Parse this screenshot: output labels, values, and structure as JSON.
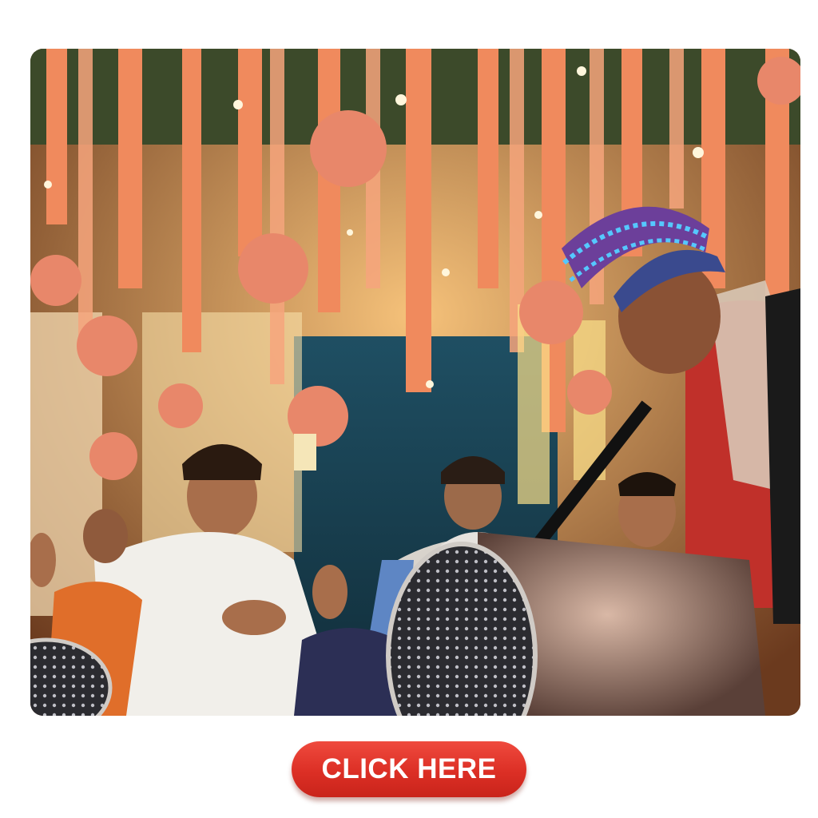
{
  "photo": {
    "subject": "wedding-celebration-dhol-photo"
  },
  "cta": {
    "label": "CLICK HERE",
    "color": "#e0332a",
    "text_color": "#ffffff"
  }
}
